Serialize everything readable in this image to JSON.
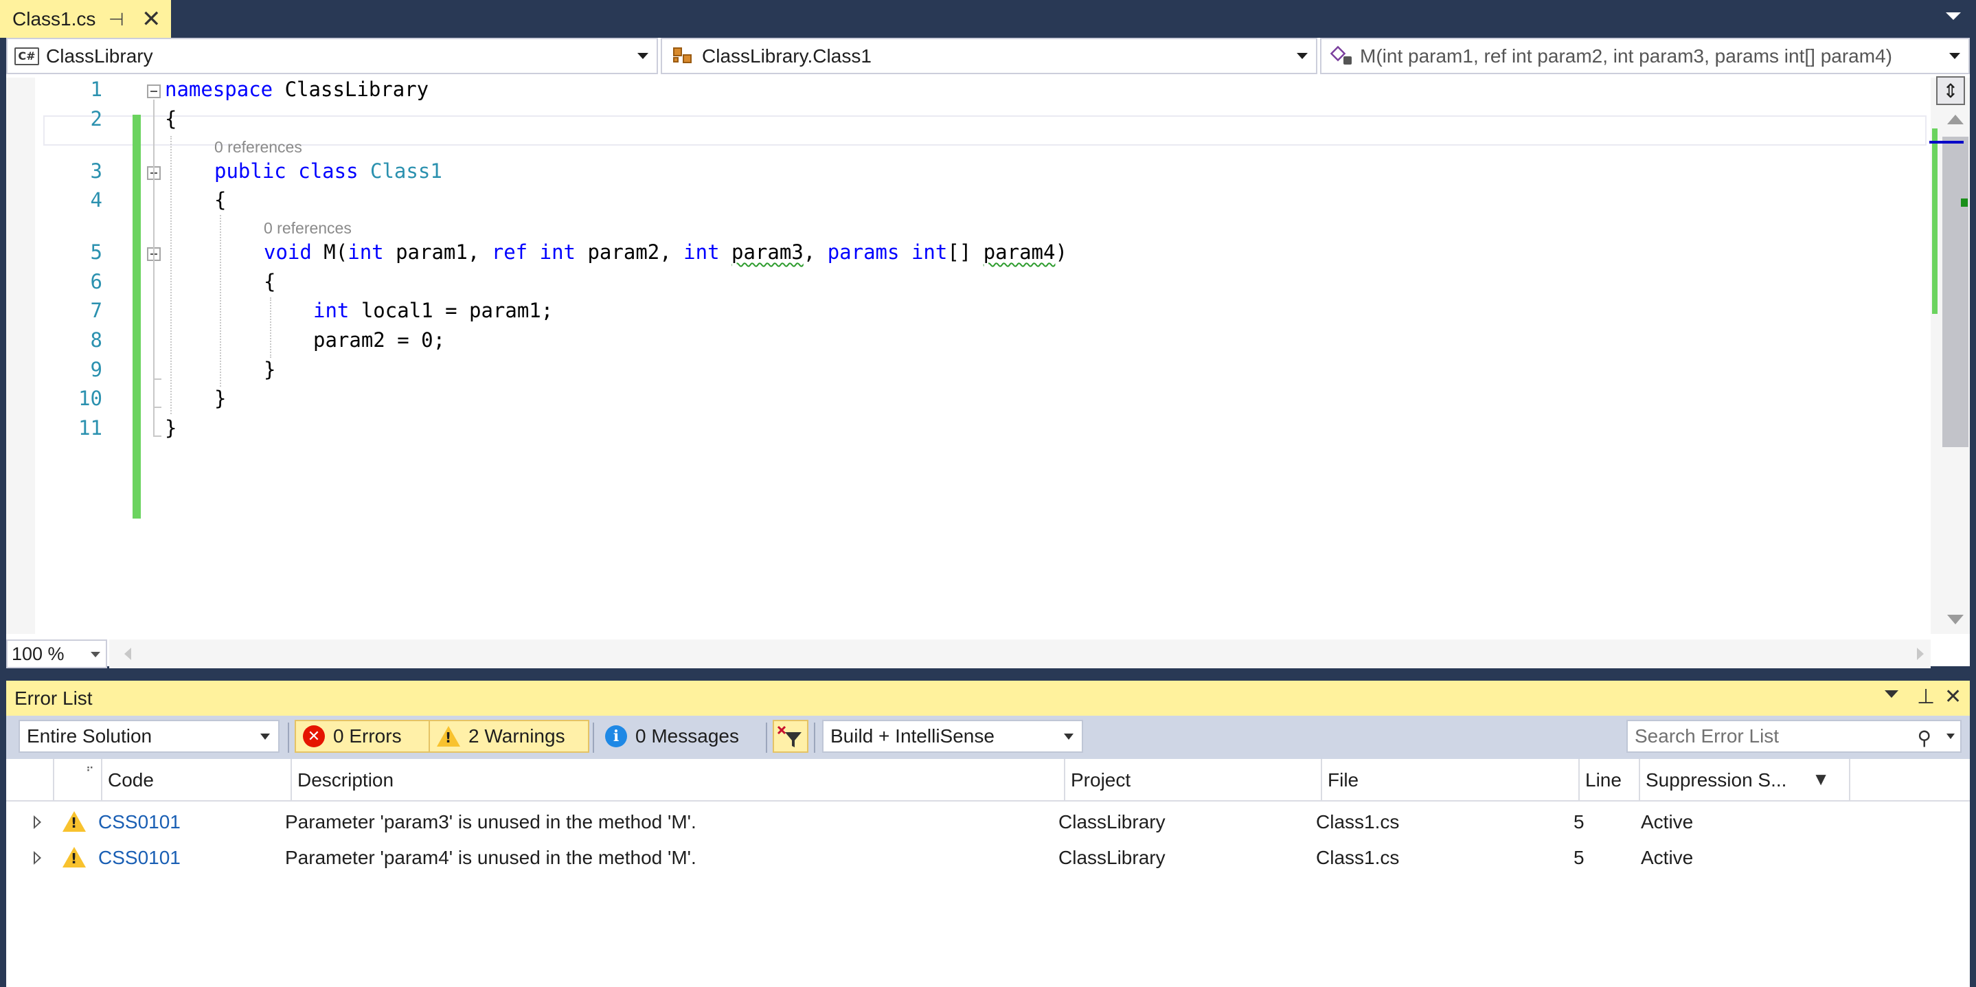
{
  "document_tab": {
    "title": "Class1.cs"
  },
  "navbar": {
    "project": "ClassLibrary",
    "type": "ClassLibrary.Class1",
    "member": "M(int param1, ref int param2, int param3, params int[] param4)"
  },
  "editor": {
    "line_numbers": [
      "1",
      "2",
      "3",
      "4",
      "5",
      "6",
      "7",
      "8",
      "9",
      "10",
      "11"
    ],
    "codelens": [
      "0 references",
      "0 references"
    ],
    "lines": {
      "l1": {
        "kw": "namespace",
        "rest": " ClassLibrary"
      },
      "l2": "{",
      "l3": {
        "kw1": "public",
        "kw2": "class",
        "type": "Class1"
      },
      "l4": "{",
      "l5": {
        "kw_void": "void",
        "name": " M(",
        "kw_int1": "int",
        "p1": " param1, ",
        "kw_ref": "ref",
        "kw_int2": "int",
        "p2": " param2, ",
        "kw_int3": "int",
        "p3": "param3",
        "comma": ", ",
        "kw_params": "params",
        "kw_int4": "int",
        "arr": "[] ",
        "p4": "param4",
        "close": ")"
      },
      "l6": "{",
      "l7": {
        "kw": "int",
        "rest": " local1 = param1;"
      },
      "l8": "param2 = 0;",
      "l9": "}",
      "l10": "}",
      "l11": "}"
    },
    "zoom": "100 %"
  },
  "error_list": {
    "title": "Error List",
    "scope": "Entire Solution",
    "errors_label": "0 Errors",
    "warnings_label": "2 Warnings",
    "messages_label": "0 Messages",
    "build_filter": "Build + IntelliSense",
    "search_placeholder": "Search Error List",
    "columns": [
      "Code",
      "Description",
      "Project",
      "File",
      "Line",
      "Suppression S..."
    ],
    "rows": [
      {
        "code": "CSS0101",
        "description": "Parameter 'param3' is unused in the method 'M'.",
        "project": "ClassLibrary",
        "file": "Class1.cs",
        "line": "5",
        "suppression": "Active"
      },
      {
        "code": "CSS0101",
        "description": "Parameter 'param4' is unused in the method 'M'.",
        "project": "ClassLibrary",
        "file": "Class1.cs",
        "line": "5",
        "suppression": "Active"
      }
    ]
  },
  "colors": {
    "chrome": "#293955",
    "active_tab": "#FFF29D",
    "keyword": "#0000FF",
    "type": "#2B91AF",
    "change_bar": "#6BD35F"
  },
  "icons": [
    "pin-icon",
    "close-icon",
    "csharp-project-icon",
    "class-icon",
    "method-icon",
    "split-icon",
    "error-icon",
    "warning-icon",
    "info-icon",
    "clear-filter-icon",
    "search-icon",
    "filter-icon"
  ]
}
